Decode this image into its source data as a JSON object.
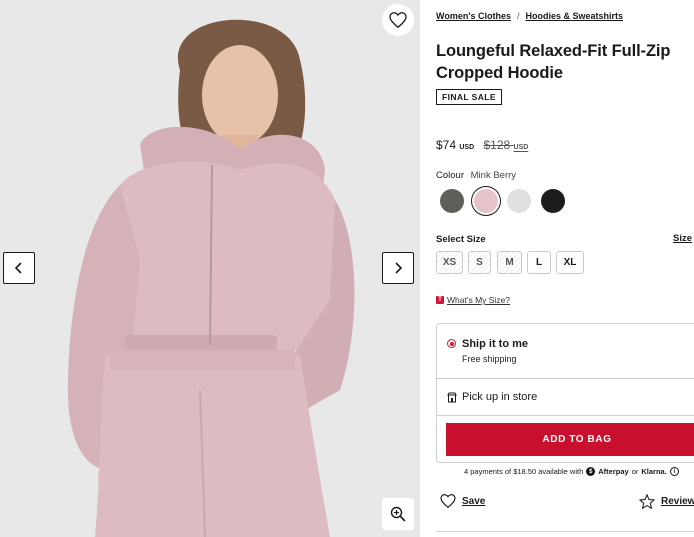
{
  "breadcrumb": {
    "items": [
      "Women's Clothes",
      "Hoodies & Sweatshirts"
    ],
    "separator": "/"
  },
  "product": {
    "title": "Loungeful Relaxed-Fit Full-Zip Cropped Hoodie",
    "badge": "FINAL SALE",
    "price": "$74",
    "price_currency": "USD",
    "original_price": "$128",
    "original_currency": "USD"
  },
  "colour": {
    "label": "Colour",
    "selected": "Mink Berry",
    "swatches": [
      {
        "name": "grey-sage",
        "color": "#5f5f59"
      },
      {
        "name": "mink-berry",
        "color": "#e6c3ca",
        "selected": true
      },
      {
        "name": "light-grey",
        "color": "#e0e0e0"
      },
      {
        "name": "black",
        "color": "#1c1c1c"
      }
    ]
  },
  "size": {
    "label": "Select Size",
    "guide_label": "Size",
    "options": [
      {
        "label": "XS",
        "available": false
      },
      {
        "label": "S",
        "available": false
      },
      {
        "label": "M",
        "available": false
      },
      {
        "label": "L",
        "available": true
      },
      {
        "label": "XL",
        "available": true
      }
    ],
    "whats_my_size": "What's My Size?"
  },
  "fulfilment": {
    "ship_title": "Ship it to me",
    "ship_sub": "Free shipping",
    "pickup_title": "Pick up in store",
    "add_to_bag": "ADD TO BAG"
  },
  "payments": {
    "text": "4 payments of $18.50 available with",
    "afterpay": "Afterpay",
    "or": "or",
    "klarna": "Klarna."
  },
  "actions": {
    "save": "Save",
    "reviews": "Reviews"
  },
  "colors": {
    "accent": "#c8102e",
    "hoodie": "#dcbcc0",
    "background": "#e9e9e9"
  },
  "icons": [
    "heart-icon",
    "chevron-left-icon",
    "chevron-right-icon",
    "zoom-in-icon",
    "store-icon",
    "star-icon",
    "info-icon"
  ]
}
